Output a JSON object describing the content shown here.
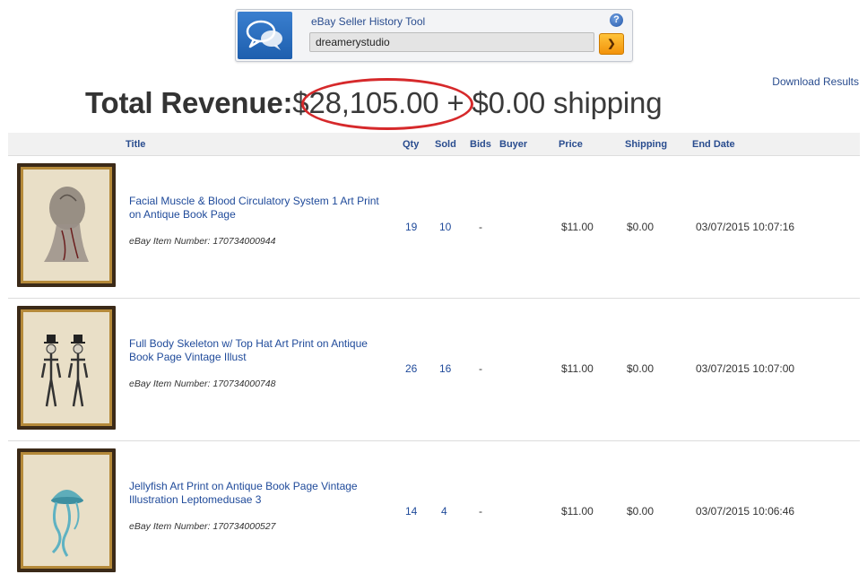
{
  "tool": {
    "title": "eBay Seller History Tool",
    "search_value": "dreamerystudio",
    "go_label": "❯",
    "help_label": "?"
  },
  "download_label": "Download Results",
  "revenue": {
    "label": "Total Revenue:",
    "amount": "$28,105.00",
    "rest": " + $0.00 shipping"
  },
  "columns": {
    "title": "Title",
    "qty": "Qty",
    "sold": "Sold",
    "bids": "Bids",
    "buyer": "Buyer",
    "price": "Price",
    "shipping": "Shipping",
    "end_date": "End Date"
  },
  "items": [
    {
      "title": "Facial Muscle & Blood Circulatory System 1 Art Print on Antique Book Page",
      "item_number": "eBay Item Number: 170734000944",
      "qty": "19",
      "sold": "10",
      "bids": "-",
      "buyer": "",
      "price": "$11.00",
      "shipping": "$0.00",
      "end_date": "03/07/2015 10:07:16"
    },
    {
      "title": "Full Body Skeleton w/ Top Hat Art Print on Antique Book Page Vintage Illust",
      "item_number": "eBay Item Number: 170734000748",
      "qty": "26",
      "sold": "16",
      "bids": "-",
      "buyer": "",
      "price": "$11.00",
      "shipping": "$0.00",
      "end_date": "03/07/2015 10:07:00"
    },
    {
      "title": "Jellyfish Art Print on Antique Book Page Vintage Illustration Leptomedusae 3",
      "item_number": "eBay Item Number: 170734000527",
      "qty": "14",
      "sold": "4",
      "bids": "-",
      "buyer": "",
      "price": "$11.00",
      "shipping": "$0.00",
      "end_date": "03/07/2015 10:06:46"
    }
  ],
  "colors": {
    "link": "#1f4a9a",
    "accent_orange": "#f2930b",
    "circle_red": "#d6292b"
  }
}
